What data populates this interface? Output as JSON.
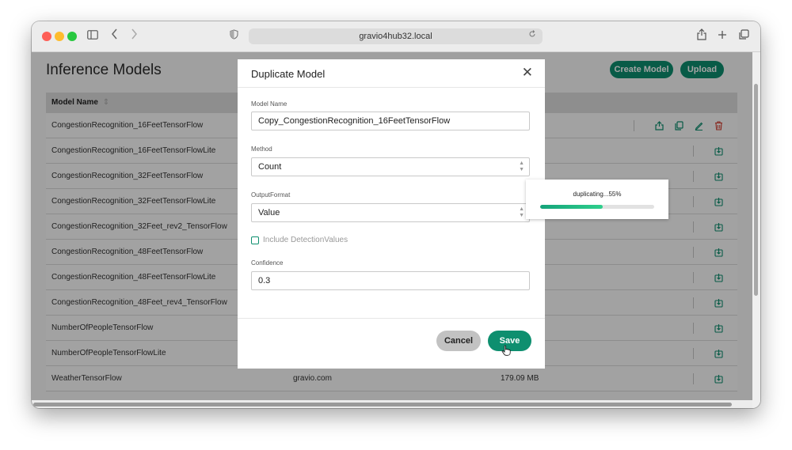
{
  "browser": {
    "url": "gravio4hub32.local"
  },
  "page": {
    "title": "Inference Models",
    "create_model_label": "Create Model",
    "upload_label": "Upload"
  },
  "table": {
    "header": "Model Name",
    "rows": [
      {
        "name": "CongestionRecognition_16FeetTensorFlow",
        "developer": "",
        "size": ""
      },
      {
        "name": "CongestionRecognition_16FeetTensorFlowLite",
        "developer": "",
        "size": ""
      },
      {
        "name": "CongestionRecognition_32FeetTensorFlow",
        "developer": "",
        "size": ""
      },
      {
        "name": "CongestionRecognition_32FeetTensorFlowLite",
        "developer": "",
        "size": ""
      },
      {
        "name": "CongestionRecognition_32Feet_rev2_TensorFlow",
        "developer": "",
        "size": ""
      },
      {
        "name": "CongestionRecognition_48FeetTensorFlow",
        "developer": "",
        "size": ""
      },
      {
        "name": "CongestionRecognition_48FeetTensorFlowLite",
        "developer": "",
        "size": ""
      },
      {
        "name": "CongestionRecognition_48Feet_rev4_TensorFlow",
        "developer": "",
        "size": ""
      },
      {
        "name": "NumberOfPeopleTensorFlow",
        "developer": "",
        "size": ""
      },
      {
        "name": "NumberOfPeopleTensorFlowLite",
        "developer": "",
        "size": ""
      },
      {
        "name": "WeatherTensorFlow",
        "developer": "gravio.com",
        "size": "179.09 MB"
      }
    ]
  },
  "modal": {
    "title": "Duplicate Model",
    "close_glyph": "✕",
    "model_name_label": "Model Name",
    "model_name_value": "Copy_CongestionRecognition_16FeetTensorFlow",
    "method_label": "Method",
    "method_value": "Count",
    "output_format_label": "OutputFormat",
    "output_format_value": "Value",
    "include_detection_label": "Include DetectionValues",
    "include_detection_checked": false,
    "confidence_label": "Confidence",
    "confidence_value": "0.3",
    "cancel_label": "Cancel",
    "save_label": "Save"
  },
  "progress": {
    "text": "duplicating...55%",
    "percent": 55
  },
  "colors": {
    "accent": "#0e8f6f",
    "delete": "#d33a2c",
    "progress_start": "#14a37a",
    "progress_end": "#2fcf8c"
  },
  "icons": {
    "share": "share-icon",
    "duplicate": "duplicate-icon",
    "edit": "edit-icon",
    "delete": "trash-icon",
    "download": "download-icon"
  }
}
